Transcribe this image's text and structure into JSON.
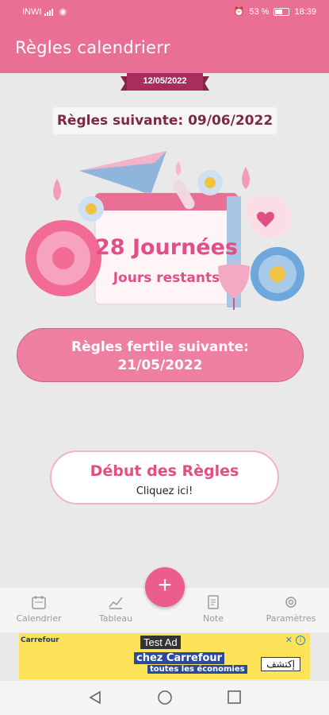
{
  "status_bar": {
    "carrier": "INWI",
    "battery": "53 %",
    "time": "18:39"
  },
  "app_bar": {
    "title": "Règles calendrierr"
  },
  "date_ribbon": "12/05/2022",
  "next_period": "Règles suivante: 09/06/2022",
  "countdown": {
    "days": "28 Journées",
    "label": "Jours restants"
  },
  "fertile": {
    "label": "Règles fertile suivante:",
    "date": "21/05/2022"
  },
  "start_button": {
    "title": "Début des Règles",
    "subtitle": "Cliquez ici!"
  },
  "fab": {
    "label": "+"
  },
  "bottom_nav": {
    "items": [
      {
        "label": "Calendrier",
        "icon": "calendar-icon"
      },
      {
        "label": "Tableau",
        "icon": "chart-icon"
      },
      {
        "label": "Note",
        "icon": "note-icon"
      },
      {
        "label": "Paramètres",
        "icon": "gear-icon"
      }
    ]
  },
  "ad": {
    "brand": "Carrefour",
    "badge": "Test Ad",
    "line1": "chez Carrefour",
    "line2": "toutes les économies",
    "cta": "إكتشف"
  },
  "colors": {
    "primary": "#ea6f95",
    "accent": "#e24e86",
    "ribbon": "#a72e5c",
    "background": "#e9e9e9"
  }
}
